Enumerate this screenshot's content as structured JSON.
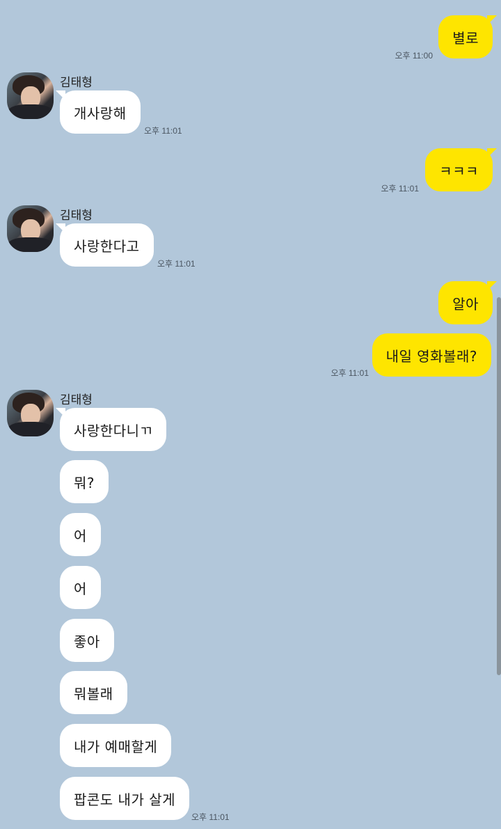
{
  "contact": {
    "name": "김태형",
    "avatar": "profile-photo"
  },
  "messages": [
    {
      "from": "me",
      "text": "별로",
      "time": "오후 11:00"
    },
    {
      "from": "them",
      "text": "개사랑해",
      "time": "오후 11:01"
    },
    {
      "from": "me",
      "text": "ㅋㅋㅋ",
      "time": "오후 11:01"
    },
    {
      "from": "them",
      "text": "사랑한다고",
      "time": "오후 11:01"
    },
    {
      "from": "me",
      "text": "알아",
      "time": ""
    },
    {
      "from": "me",
      "text": "내일 영화볼래?",
      "time": "오후 11:01"
    },
    {
      "from": "them",
      "text": "사랑한다니ㄲ",
      "time": ""
    },
    {
      "from": "them",
      "text": "뭐?",
      "time": ""
    },
    {
      "from": "them",
      "text": "어",
      "time": ""
    },
    {
      "from": "them",
      "text": "어",
      "time": ""
    },
    {
      "from": "them",
      "text": "좋아",
      "time": ""
    },
    {
      "from": "them",
      "text": "뭐볼래",
      "time": ""
    },
    {
      "from": "them",
      "text": "내가 예매할게",
      "time": ""
    },
    {
      "from": "them",
      "text": "팝콘도 내가 살게",
      "time": "오후 11:01"
    }
  ],
  "colors": {
    "background": "#b2c7da",
    "mine": "#fee500",
    "theirs": "#ffffff"
  }
}
